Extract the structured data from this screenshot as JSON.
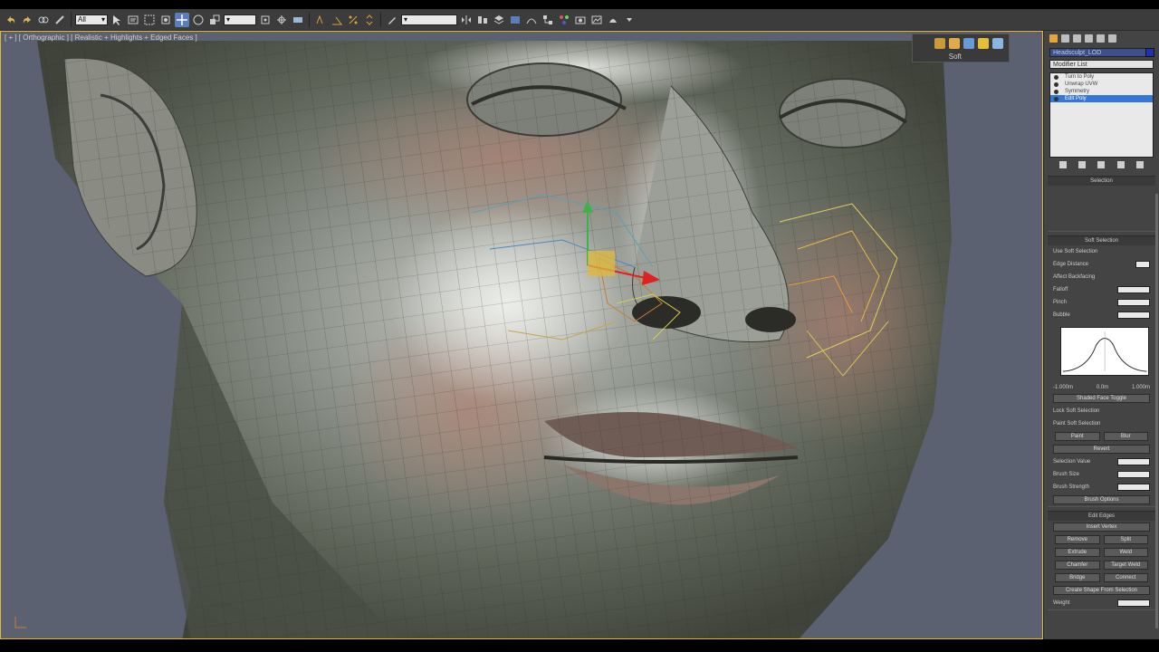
{
  "toolbar": {
    "selection_filter": "All",
    "named_selection": "",
    "create_selection": ""
  },
  "viewport": {
    "label": "[ + ] [ Orthographic ] [ Realistic + Highlights + Edged Faces ]",
    "floating_toolbar_label": "Soft"
  },
  "panel": {
    "object_name": "Headsculpt_LOD",
    "modifier_list": "Modifier List",
    "stack_items": [
      "Turn to Poly",
      "Unwrap UVW",
      "Symmetry",
      "Edit Poly"
    ],
    "selected_stack_index": 3,
    "rollouts": {
      "selection": "Selection",
      "soft_selection": "Soft Selection",
      "paint_soft": "Paint Soft Selection",
      "edit_edges": "Edit Edges"
    },
    "fields": {
      "use_soft": "Use Soft Selection",
      "edge_distance": "Edge Distance",
      "affect_backfacing": "Affect Backfacing",
      "falloff": "Falloff",
      "pinch": "Pinch",
      "bubble": "Bubble",
      "shaded_face_toggle": "Shaded Face Toggle",
      "lock_soft": "Lock Soft Selection",
      "paint": "Paint",
      "blur": "Blur",
      "revert": "Revert",
      "selection_value": "Selection Value",
      "brush_size": "Brush Size",
      "brush_strength": "Brush Strength",
      "brush_options": "Brush Options",
      "insert_vertex": "Insert Vertex",
      "remove": "Remove",
      "split": "Split",
      "extrude": "Extrude",
      "weld": "Weld",
      "chamfer": "Chamfer",
      "target_weld": "Target Weld",
      "bridge": "Bridge",
      "connect": "Connect",
      "create_shape": "Create Shape From Selection",
      "weight": "Weight"
    },
    "curve_ticks": [
      "-1.000m",
      "0.0m",
      "1.000m"
    ]
  }
}
